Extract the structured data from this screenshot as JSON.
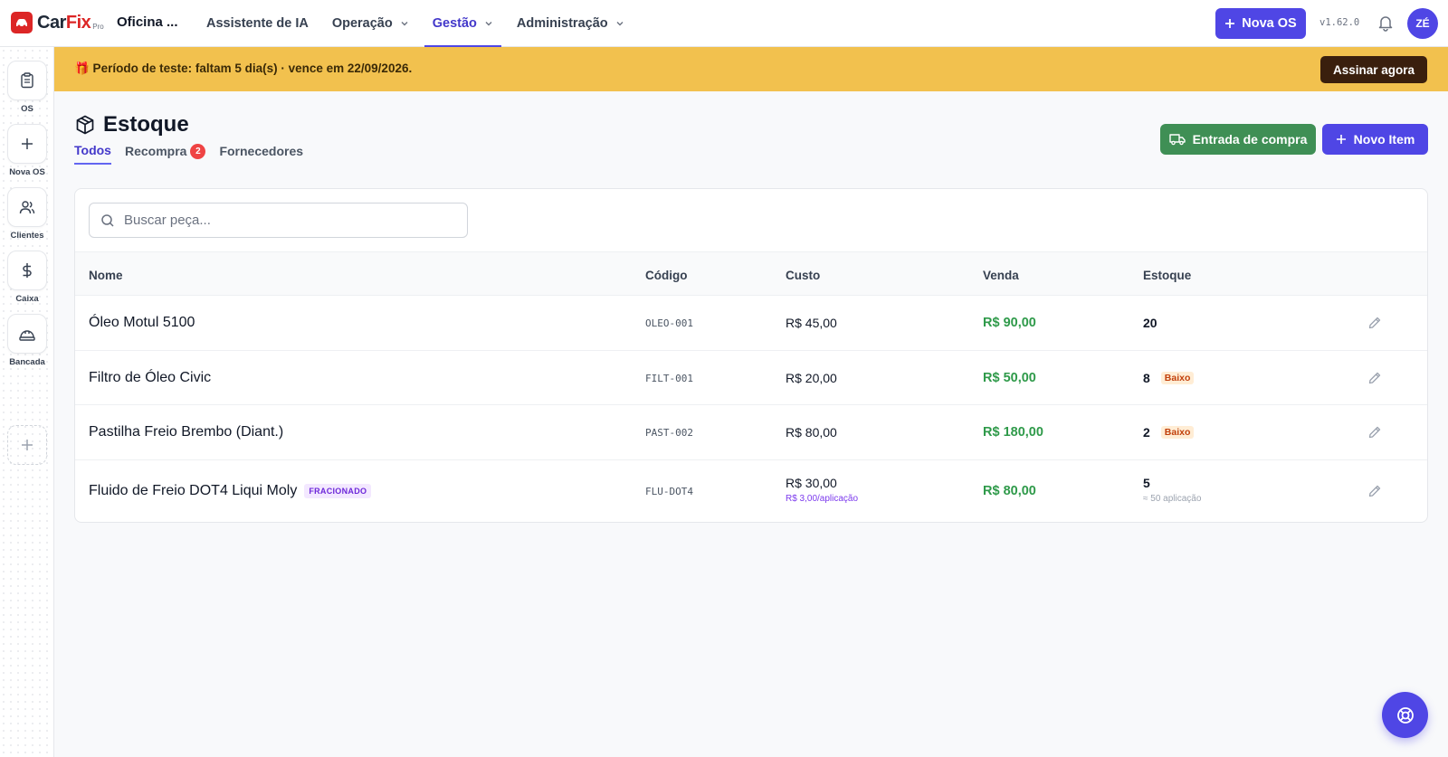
{
  "app": {
    "brand_car": "Car",
    "brand_fix": "Fix",
    "brand_pro": "Pro",
    "workshop_name": "Oficina ..."
  },
  "nav": {
    "links": [
      {
        "label": "Assistente de IA",
        "dropdown": false,
        "active": false
      },
      {
        "label": "Operação",
        "dropdown": true,
        "active": false
      },
      {
        "label": "Gestão",
        "dropdown": true,
        "active": true
      },
      {
        "label": "Administração",
        "dropdown": true,
        "active": false
      }
    ],
    "new_os_label": "Nova OS",
    "version": "v1.62.0",
    "avatar_initials": "ZÉ"
  },
  "sidebar": {
    "items": [
      {
        "label": "OS",
        "icon": "clipboard-icon"
      },
      {
        "label": "Nova OS",
        "icon": "plus-icon"
      },
      {
        "label": "Clientes",
        "icon": "users-icon"
      },
      {
        "label": "Caixa",
        "icon": "dollar-icon"
      },
      {
        "label": "Bancada",
        "icon": "workbench-icon"
      }
    ]
  },
  "banner": {
    "text": "🎁 Período de teste: faltam 5 dia(s) · vence em 22/09/2026.",
    "cta": "Assinar agora"
  },
  "page": {
    "title": "Estoque",
    "tabs": [
      {
        "label": "Todos",
        "active": true,
        "badge": null
      },
      {
        "label": "Recompra",
        "active": false,
        "badge": "2"
      },
      {
        "label": "Fornecedores",
        "active": false,
        "badge": null
      }
    ],
    "entrada_label": "Entrada de compra",
    "novo_item_label": "Novo Item"
  },
  "search": {
    "placeholder": "Buscar peça...",
    "value": ""
  },
  "table": {
    "headers": {
      "name": "Nome",
      "code": "Código",
      "cost": "Custo",
      "sale": "Venda",
      "stock": "Estoque"
    },
    "rows": [
      {
        "name": "Óleo Motul 5100",
        "badge": "",
        "code": "OLEO-001",
        "cost": "R$ 45,00",
        "cost_sub": "",
        "sale": "R$ 90,00",
        "stock": "20",
        "stock_badge": "",
        "stock_sub": ""
      },
      {
        "name": "Filtro de Óleo Civic",
        "badge": "",
        "code": "FILT-001",
        "cost": "R$ 20,00",
        "cost_sub": "",
        "sale": "R$ 50,00",
        "stock": "8",
        "stock_badge": "Baixo",
        "stock_sub": ""
      },
      {
        "name": "Pastilha Freio Brembo (Diant.)",
        "badge": "",
        "code": "PAST-002",
        "cost": "R$ 80,00",
        "cost_sub": "",
        "sale": "R$ 180,00",
        "stock": "2",
        "stock_badge": "Baixo",
        "stock_sub": ""
      },
      {
        "name": "Fluido de Freio DOT4 Liqui Moly",
        "badge": "FRACIONADO",
        "code": "FLU-DOT4",
        "cost": "R$ 30,00",
        "cost_sub": "R$ 3,00/aplicação",
        "sale": "R$ 80,00",
        "stock": "5",
        "stock_badge": "",
        "stock_sub": "≈ 50 aplicação"
      }
    ]
  },
  "colors": {
    "accent": "#4f46e5",
    "banner": "#f2c14e",
    "success": "#2f9a4a",
    "danger": "#dc2626"
  }
}
